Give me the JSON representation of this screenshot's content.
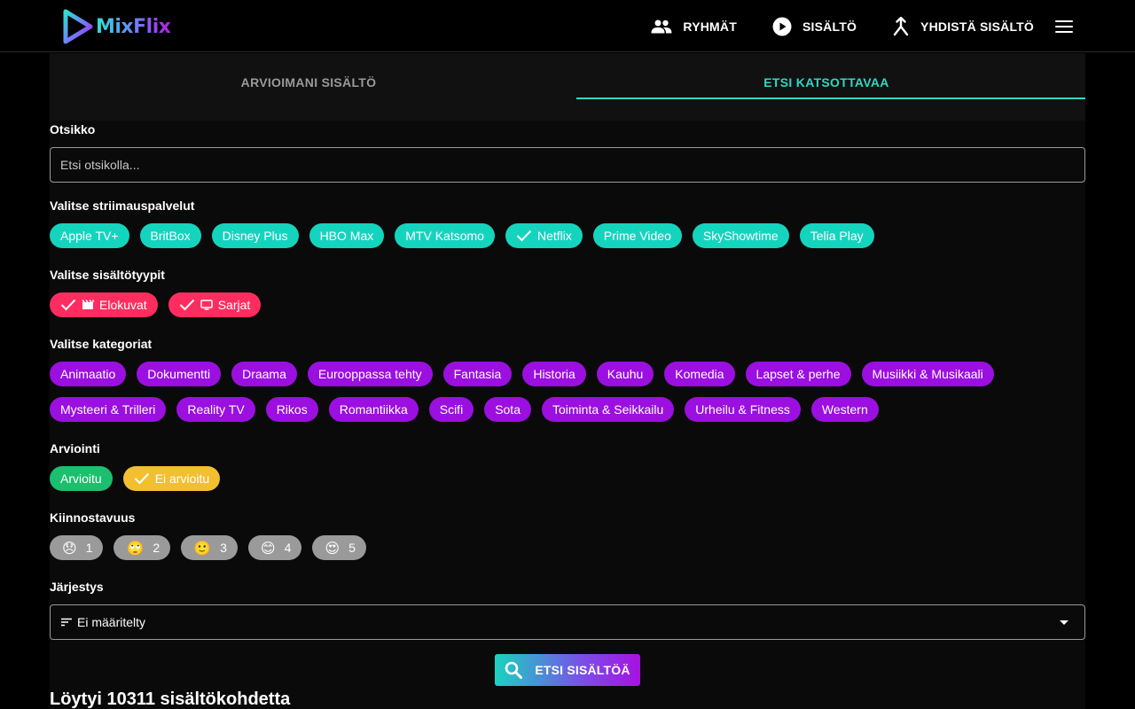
{
  "brand": {
    "name": "MixFlix"
  },
  "nav": [
    {
      "label": "RYHMÄT",
      "icon": "group-icon"
    },
    {
      "label": "SISÄLTÖ",
      "icon": "play-circle-icon"
    },
    {
      "label": "YHDISTÄ SISÄLTÖ",
      "icon": "merge-icon"
    }
  ],
  "tabs": [
    {
      "label": "ARVIOIMANI SISÄLTÖ",
      "active": false
    },
    {
      "label": "ETSI KATSOTTAVAA",
      "active": true
    }
  ],
  "title_filter": {
    "label": "Otsikko",
    "placeholder": "Etsi otsikolla...",
    "value": ""
  },
  "streaming": {
    "label": "Valitse striimauspalvelut",
    "items": [
      "Apple TV+",
      "BritBox",
      "Disney Plus",
      "HBO Max",
      "MTV Katsomo",
      "Netflix",
      "Prime Video",
      "SkyShowtime",
      "Telia Play"
    ],
    "selected": [
      "Netflix"
    ]
  },
  "content_types": {
    "label": "Valitse sisältötyypit",
    "items": [
      {
        "label": "Elokuvat",
        "icon": "movie-icon",
        "selected": true
      },
      {
        "label": "Sarjat",
        "icon": "tv-icon",
        "selected": true
      }
    ]
  },
  "categories": {
    "label": "Valitse kategoriat",
    "row1": [
      "Animaatio",
      "Dokumentti",
      "Draama",
      "Eurooppassa tehty",
      "Fantasia",
      "Historia",
      "Kauhu",
      "Komedia",
      "Lapset & perhe",
      "Musiikki & Musikaali"
    ],
    "row2": [
      "Mysteeri & Trilleri",
      "Reality TV",
      "Rikos",
      "Romantiikka",
      "Scifi",
      "Sota",
      "Toiminta & Seikkailu",
      "Urheilu & Fitness",
      "Western"
    ]
  },
  "rating": {
    "label": "Arviointi",
    "items": [
      {
        "label": "Arvioitu",
        "selected": false
      },
      {
        "label": "Ei arvioitu",
        "selected": true
      }
    ]
  },
  "interest": {
    "label": "Kiinnostavuus",
    "items": [
      {
        "emoji": "😞",
        "value": "1"
      },
      {
        "emoji": "🙄",
        "value": "2"
      },
      {
        "emoji": "🙂",
        "value": "3"
      },
      {
        "emoji": "😊",
        "value": "4"
      },
      {
        "emoji": "😍",
        "value": "5"
      }
    ]
  },
  "sort": {
    "label": "Järjestys",
    "value": "Ei määritelty"
  },
  "search_button": {
    "label": "ETSI SISÄLTÖÄ"
  },
  "result_text": "Löytyi 10311 sisältökohdetta",
  "colors": {
    "streaming_chip": "#15d4be",
    "type_chip": "#ff2d5f",
    "category_chip": "#9b0fe0",
    "rated_chip": "#1bbf6e",
    "not_rated_chip": "#f2bf30",
    "interest_chip": "#9a9a9a",
    "accent": "#2ed8c3"
  }
}
